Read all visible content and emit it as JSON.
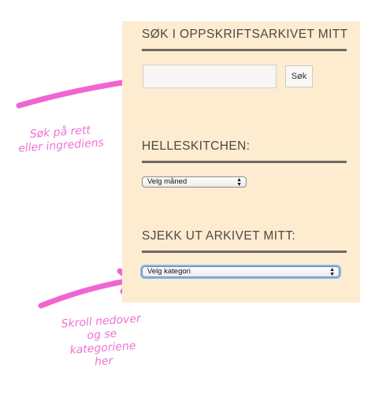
{
  "search_widget": {
    "title": "SØK I OPPSKRIFTSARKIVET MITT",
    "input_value": "",
    "input_placeholder": "",
    "button_label": "Søk"
  },
  "month_widget": {
    "title": "HELLESKITCHEN:",
    "select_value": "Velg måned"
  },
  "archive_widget": {
    "title": "SJEKK UT ARKIVET MITT:",
    "select_value": "Velg kategori"
  },
  "annotations": {
    "search_note": "Søk på rett\neller ingrediens",
    "scroll_note": "Skroll nedover\nog se\nkategoriene\nher",
    "color": "#ee73d3"
  },
  "colors": {
    "sidebar_bg": "#fdecd0",
    "rule": "#6f6965",
    "title_text": "#4e4844"
  }
}
